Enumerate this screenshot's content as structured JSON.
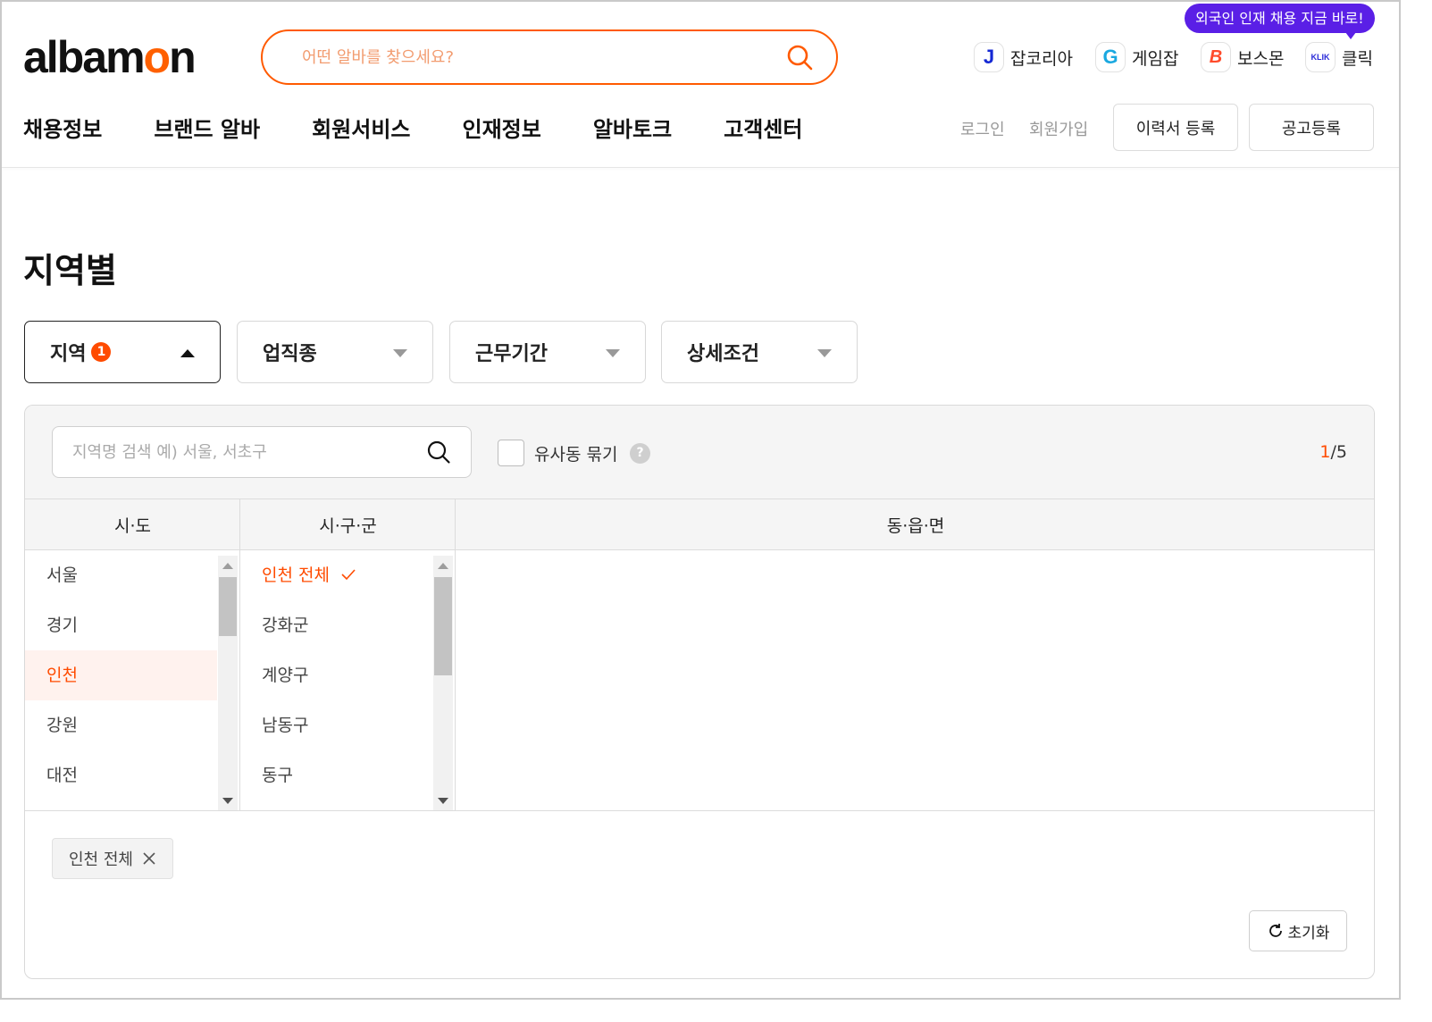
{
  "header": {
    "logo": {
      "part1": "alba",
      "part2": "m",
      "part3": "o",
      "part4": "n"
    },
    "search_placeholder": "어떤 알바를 찾으세요?",
    "promo_tooltip": "외국인 인재 채용 지금 바로!",
    "family_sites": [
      {
        "badge": "J",
        "label": "잡코리아",
        "badge_color": "#1428d4"
      },
      {
        "badge": "G",
        "label": "게임잡",
        "badge_color": "#1aa8e0"
      },
      {
        "badge": "B",
        "label": "보스몬",
        "badge_color": "#ff4b2b"
      },
      {
        "badge": "KLIK",
        "label": "클릭",
        "badge_color": "#2a2ad8"
      }
    ]
  },
  "gnb": [
    "채용정보",
    "브랜드 알바",
    "회원서비스",
    "인재정보",
    "알바토크",
    "고객센터"
  ],
  "utility": {
    "login": "로그인",
    "signup": "회원가입",
    "resume_button": "이력서 등록",
    "post_button": "공고등록"
  },
  "page_title": "지역별",
  "filters": [
    {
      "label": "지역",
      "count": "1",
      "active": true
    },
    {
      "label": "업직종",
      "active": false
    },
    {
      "label": "근무기간",
      "active": false
    },
    {
      "label": "상세조건",
      "active": false
    }
  ],
  "region_panel": {
    "search_placeholder": "지역명 검색 예) 서울, 서초구",
    "group_similar_label": "유사동 묶기",
    "help": "?",
    "pager": {
      "current": "1",
      "total": "/5"
    },
    "columns": [
      "시·도",
      "시·구·군",
      "동·읍·면"
    ],
    "sido": [
      "서울",
      "경기",
      "인천",
      "강원",
      "대전"
    ],
    "sido_selected": "인천",
    "sigungu": [
      "인천 전체",
      "강화군",
      "계양구",
      "남동구",
      "동구"
    ],
    "sigungu_selected": "인천 전체",
    "selected_chip": "인천 전체",
    "reset_label": "초기화"
  },
  "colors": {
    "accent": "#ff5a00",
    "badge": "#ff4b00",
    "promo": "#5a1fe6"
  }
}
